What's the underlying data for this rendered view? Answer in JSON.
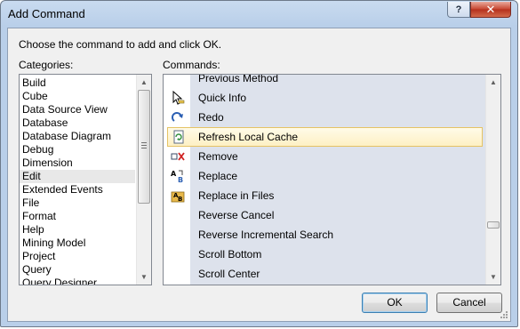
{
  "window": {
    "title": "Add Command",
    "help_label": "?",
    "close_label": "✕"
  },
  "dialog": {
    "instruction": "Choose the command to add and click OK.",
    "categories_label": "Categories:",
    "commands_label": "Commands:"
  },
  "categories": {
    "items": [
      "Build",
      "Cube",
      "Data Source View",
      "Database",
      "Database Diagram",
      "Debug",
      "Dimension",
      "Edit",
      "Extended Events",
      "File",
      "Format",
      "Help",
      "Mining Model",
      "Project",
      "Query",
      "Query Designer"
    ],
    "selected": "Edit"
  },
  "commands": {
    "items": [
      {
        "label": "Previous Method",
        "icon": "none"
      },
      {
        "label": "Quick Info",
        "icon": "quick-info-icon"
      },
      {
        "label": "Redo",
        "icon": "redo-icon"
      },
      {
        "label": "Refresh Local Cache",
        "icon": "refresh-cache-icon"
      },
      {
        "label": "Remove",
        "icon": "remove-icon"
      },
      {
        "label": "Replace",
        "icon": "replace-icon"
      },
      {
        "label": "Replace in Files",
        "icon": "replace-in-files-icon"
      },
      {
        "label": "Reverse Cancel",
        "icon": "none"
      },
      {
        "label": "Reverse Incremental Search",
        "icon": "none"
      },
      {
        "label": "Scroll Bottom",
        "icon": "none"
      },
      {
        "label": "Scroll Center",
        "icon": "none"
      }
    ],
    "selected": "Refresh Local Cache"
  },
  "buttons": {
    "ok": "OK",
    "cancel": "Cancel"
  },
  "colors": {
    "selection_fill": "#fdf0c4",
    "selection_border": "#e5c365",
    "command_band": "#dde2ec",
    "title_bar": "#c9dbf0",
    "close_button": "#c7442f"
  }
}
